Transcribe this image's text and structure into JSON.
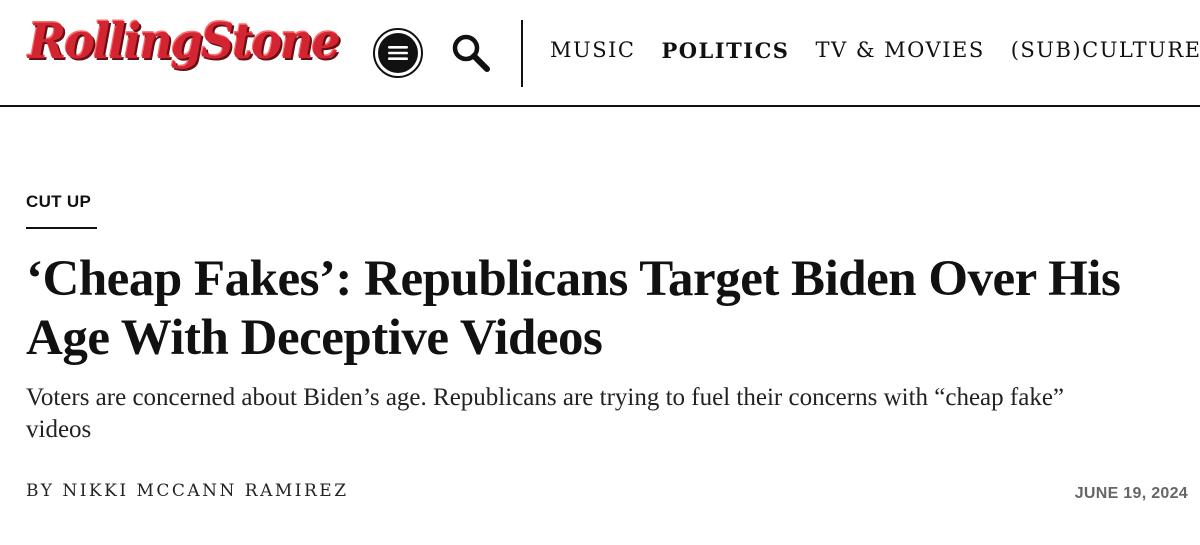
{
  "header": {
    "logo_text": "RollingStone",
    "menu_icon": "hamburger-menu-icon",
    "search_icon": "search-icon",
    "nav": [
      {
        "label": "MUSIC",
        "active": false
      },
      {
        "label": "POLITICS",
        "active": true
      },
      {
        "label": "TV & MOVIES",
        "active": false
      },
      {
        "label": "(SUB)CULTURE",
        "active": false
      }
    ]
  },
  "article": {
    "kicker": "CUT UP",
    "headline": "‘Cheap Fakes’: Republicans Target Biden Over His Age With Deceptive Videos",
    "subhead": "Voters are concerned about Biden’s age. Republicans are trying to fuel their concerns with “cheap fake” videos",
    "byline_prefix": "BY",
    "author": "NIKKI MCCANN RAMIREZ",
    "date": "JUNE 19, 2024"
  },
  "colors": {
    "brand_red": "#d32531",
    "text": "#111111",
    "date_gray": "#666666"
  }
}
